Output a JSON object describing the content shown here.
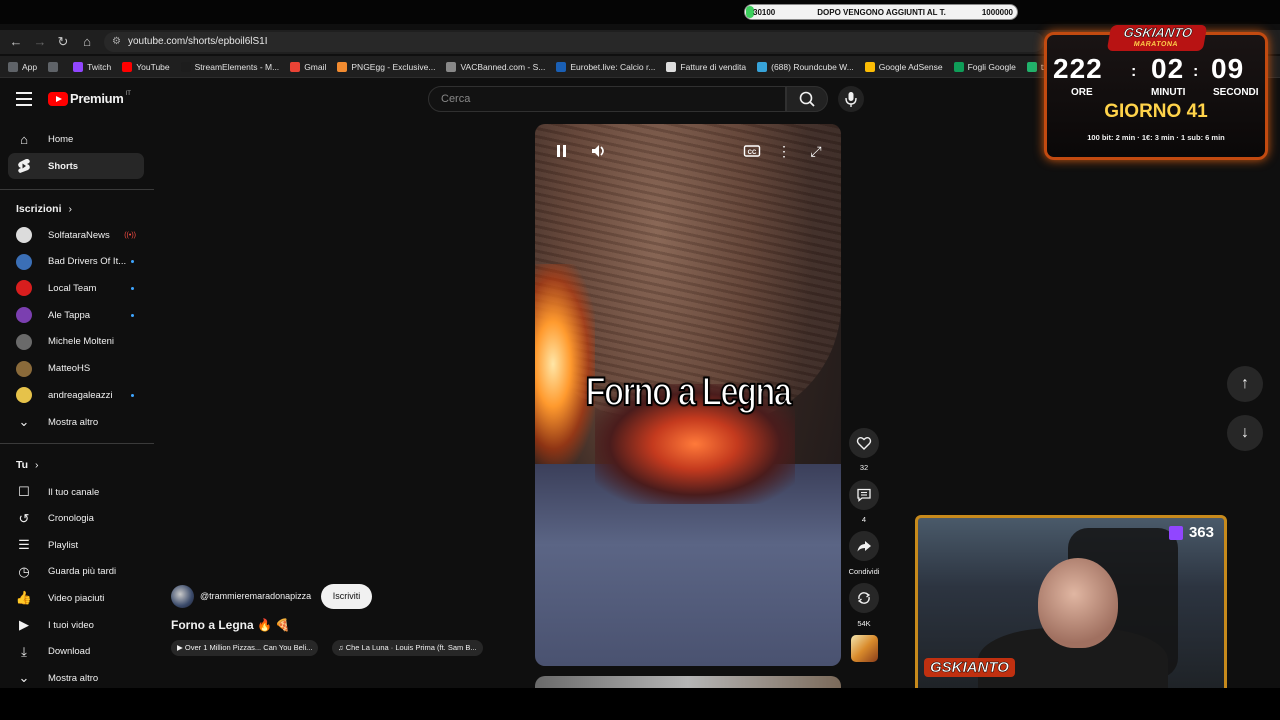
{
  "stream_goal": {
    "current": "30100",
    "label": "DOPO VENGONO AGGIUNTI AL T.",
    "target": "1000000",
    "progress": 0.0301
  },
  "browser": {
    "url": "youtube.com/shorts/epboil6lS1I",
    "bookmarks": [
      {
        "label": "App",
        "color": "#5f6368"
      },
      {
        "label": "",
        "color": "#5f6368"
      },
      {
        "label": "Twitch",
        "color": "#9146ff"
      },
      {
        "label": "YouTube",
        "color": "#ff0000"
      },
      {
        "label": "StreamElements - M...",
        "color": "#1d1d1d"
      },
      {
        "label": "Gmail",
        "color": "#ea4335"
      },
      {
        "label": "PNGEgg - Exclusive...",
        "color": "#f28b30"
      },
      {
        "label": "VACBanned.com - S...",
        "color": "#888888"
      },
      {
        "label": "Eurobet.live: Calcio r...",
        "color": "#1a5fb4"
      },
      {
        "label": "Fatture di vendita",
        "color": "#dddddd"
      },
      {
        "label": "(688) Roundcube W...",
        "color": "#37a3d9"
      },
      {
        "label": "Google AdSense",
        "color": "#fbbc05"
      },
      {
        "label": "Fogli Google",
        "color": "#0f9d58"
      },
      {
        "label": "txAdmin",
        "color": "#20b26b"
      }
    ]
  },
  "header": {
    "logo": "Premium",
    "country": "IT",
    "search_placeholder": "Cerca"
  },
  "sidebar": {
    "home": "Home",
    "shorts": "Shorts",
    "subscriptions_title": "Iscrizioni",
    "subscriptions": [
      {
        "name": "SolfataraNews",
        "badge": "live",
        "color": "#dcdcdc"
      },
      {
        "name": "Bad Drivers Of It...",
        "badge": "dot",
        "color": "#3b6fb6"
      },
      {
        "name": "Local Team",
        "badge": "dot",
        "color": "#d81e1e"
      },
      {
        "name": "Ale Tappa",
        "badge": "dot",
        "color": "#7b3fb0"
      },
      {
        "name": "Michele Molteni",
        "badge": "",
        "color": "#6a6a6a"
      },
      {
        "name": "MatteoHS",
        "badge": "",
        "color": "#8a6a3a"
      },
      {
        "name": "andreagaleazzi",
        "badge": "dot",
        "color": "#e6c24a"
      }
    ],
    "show_more_1": "Mostra altro",
    "you_title": "Tu",
    "you": [
      {
        "label": "Il tuo canale",
        "icon": "person-box-icon"
      },
      {
        "label": "Cronologia",
        "icon": "history-icon"
      },
      {
        "label": "Playlist",
        "icon": "playlist-icon"
      },
      {
        "label": "Guarda più tardi",
        "icon": "clock-icon"
      },
      {
        "label": "Video piaciuti",
        "icon": "thumbs-up-icon"
      },
      {
        "label": "I tuoi video",
        "icon": "video-icon"
      },
      {
        "label": "Download",
        "icon": "download-icon"
      }
    ],
    "show_more_2": "Mostra altro"
  },
  "video": {
    "overlay_text": "Forno a Legna",
    "channel": "@trammieremaradonapizza",
    "subscribe": "Iscriviti",
    "title": "Forno a Legna 🔥 🍕",
    "chips": [
      "Over 1 Million Pizzas... Can You Beli...",
      "Che La Luna · Louis Prima (ft. Sam B..."
    ]
  },
  "actions": {
    "likes": "32",
    "comments": "4",
    "share": "Condividi",
    "remix": "54K"
  },
  "timer": {
    "brand": "GSKIANTO",
    "subtitle": "MARATONA",
    "hours": "222",
    "minutes": "02",
    "seconds": "09",
    "hours_label": "ORE",
    "minutes_label": "MINUTI",
    "seconds_label": "SECONDI",
    "day": "GIORNO 41",
    "rules": "100 bit: 2 min · 1€: 3 min · 1 sub: 6 min"
  },
  "webcam": {
    "viewers": "363",
    "logo": "GSKIANTO"
  }
}
